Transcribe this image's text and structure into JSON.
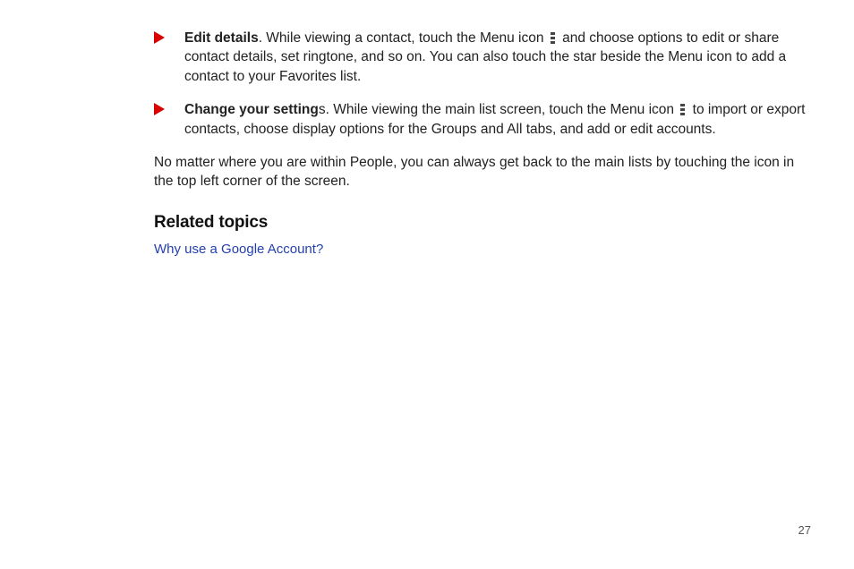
{
  "bullets": [
    {
      "title": "Edit details",
      "body_before": ". While viewing a contact, touch the Menu icon ",
      "body_after": " and choose options to edit or share contact details, set ringtone, and so on. You can also touch the star beside the Menu icon to add a contact to your Favorites list."
    },
    {
      "title": "Change your setting",
      "title_tail": "s",
      "body_before": ". While viewing the main list screen, touch the Menu icon ",
      "body_after": " to import or export contacts, choose display options for the Groups and All tabs, and add or edit accounts."
    }
  ],
  "paragraph": "No matter where you are within People, you can always get back to the main lists by touching the icon in the top left corner of the screen.",
  "related_heading": "Related topics",
  "related_link": "Why use a Google Account?",
  "page_number": "27"
}
